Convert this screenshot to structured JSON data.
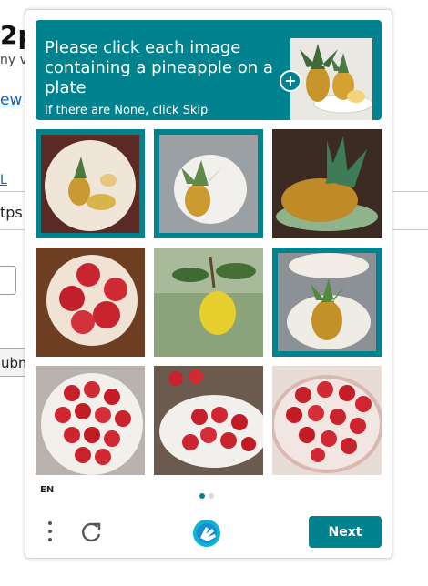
{
  "background_page": {
    "heading_fragment": "2p",
    "sub_fragment": "ny v",
    "link_fragment": "ew",
    "link2_fragment": "L",
    "url_fragment": "tps",
    "submit_fragment": "ubm"
  },
  "challenge": {
    "prompt": "Please click each image containing a pineapple on a plate",
    "hint": "If there are None, click Skip",
    "example_icon": "plus-icon",
    "tiles": [
      {
        "subject": "pineapple-on-plate",
        "selected": true
      },
      {
        "subject": "pineapple-on-plate",
        "selected": true
      },
      {
        "subject": "pineapple-on-plate",
        "selected": true
      },
      {
        "subject": "apples-in-bowl",
        "selected": false
      },
      {
        "subject": "lemon-on-branch",
        "selected": false
      },
      {
        "subject": "pineapple-on-plate",
        "selected": true
      },
      {
        "subject": "strawberries-on-plate",
        "selected": false
      },
      {
        "subject": "strawberries-on-plate",
        "selected": false
      },
      {
        "subject": "strawberries-on-plate",
        "selected": false
      }
    ],
    "language": "EN",
    "page_dots": {
      "count": 2,
      "active": 1
    },
    "next_label": "Next",
    "icons": {
      "menu": "more-vertical-icon",
      "refresh": "refresh-icon",
      "logo": "hcaptcha-logo-icon"
    },
    "colors": {
      "accent": "#00838f",
      "dot_inactive": "#d9d9d9"
    }
  }
}
